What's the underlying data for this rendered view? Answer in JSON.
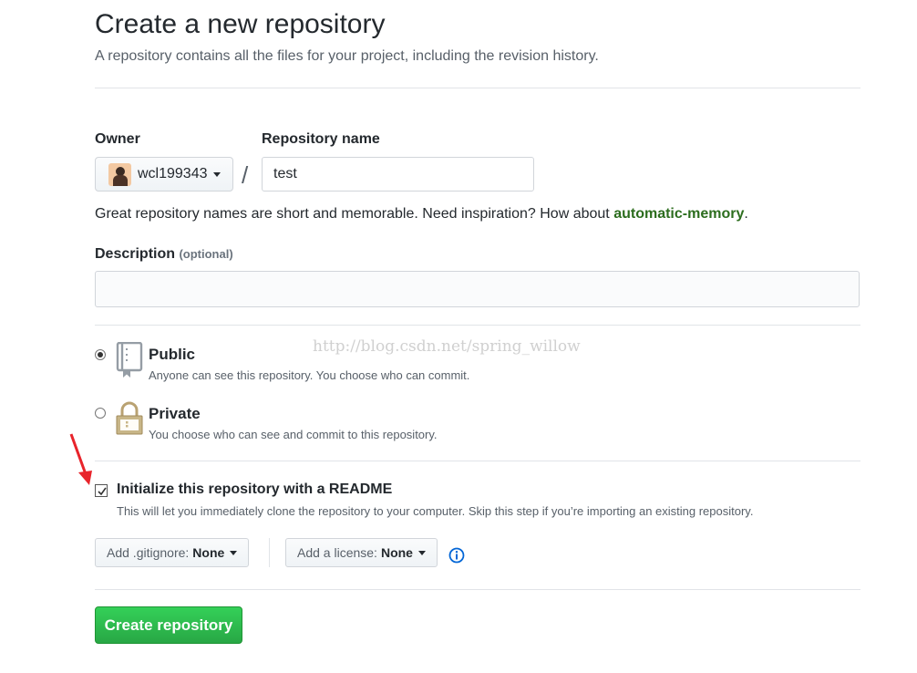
{
  "header": {
    "title": "Create a new repository",
    "subtitle": "A repository contains all the files for your project, including the revision history."
  },
  "owner": {
    "label": "Owner",
    "value": "wcl199343"
  },
  "separator": "/",
  "repo_name": {
    "label": "Repository name",
    "value": "test"
  },
  "name_hint": {
    "prefix": "Great repository names are short and memorable. Need inspiration? How about ",
    "suggestion": "automatic-memory",
    "suffix": "."
  },
  "description": {
    "label": "Description",
    "optional": "(optional)",
    "value": ""
  },
  "visibility": {
    "selected": "public",
    "public": {
      "title": "Public",
      "note": "Anyone can see this repository. You choose who can commit."
    },
    "private": {
      "title": "Private",
      "note": "You choose who can see and commit to this repository."
    }
  },
  "watermark": "http://blog.csdn.net/spring_willow",
  "readme": {
    "checked": true,
    "label": "Initialize this repository with a README",
    "note": "This will let you immediately clone the repository to your computer. Skip this step if you’re importing an existing repository."
  },
  "gitignore": {
    "label": "Add .gitignore:",
    "value": "None"
  },
  "license": {
    "label": "Add a license:",
    "value": "None"
  },
  "submit": {
    "label": "Create repository"
  },
  "colors": {
    "accent_green": "#28a745",
    "link_green": "#2c6d1e",
    "info_blue": "#0366d6",
    "arrow_red": "#e8242b"
  },
  "icons": {
    "public": "repo-book-icon",
    "private": "lock-icon",
    "info": "info-icon",
    "annotation": "red-arrow-icon"
  }
}
